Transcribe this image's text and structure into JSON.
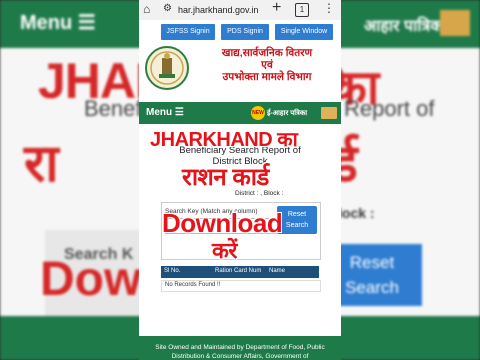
{
  "background": {
    "menu": "Menu ☰",
    "right_text": "आहार पात्रिका",
    "caption_jharkhand": "JHARKHAND",
    "caption_ka": "का",
    "report_left": "Beneficiary",
    "report_right": "Report of",
    "card_left": "रा",
    "card_right": "र्ड",
    "search_key": "Search K",
    "download": "Dow",
    "block": "lock :",
    "reset": "Reset Search"
  },
  "browser": {
    "url": "har.jharkhand.gov.in",
    "tab_count": "1",
    "home_icon": "⌂",
    "tune_icon": "⚙",
    "plus_icon": "+",
    "more_icon": "⋮"
  },
  "top_buttons": [
    "JSFSS Signin",
    "PDS Signin",
    "Single Window"
  ],
  "department": {
    "line1": "खाद्य,सार्वजनिक वितरण",
    "line2": "एवं",
    "line3": "उपभोक्ता मामले विभाग"
  },
  "nav": {
    "menu": "Menu ☰",
    "new_badge": "NEW",
    "eahar": "ई-आहार पत्रिका"
  },
  "section": {
    "title_line1": "Beneficiary Search Report of",
    "title_line2": "District  Block",
    "district_label": "District : , Block :",
    "search_key": "Search Key (Match any column)",
    "reset_button": "Reset Search"
  },
  "table": {
    "headers": [
      "Sl No.",
      "Ration Card Num",
      "Name"
    ],
    "empty_message": "No Records Found !!"
  },
  "footer": {
    "text": "Site Owned and Maintained by Department of Food, Public Distribution & Consumer Affairs, Government of"
  },
  "overlay_caption": {
    "line1": "JHARKHAND का",
    "line2": "राशन कार्ड",
    "line3": "Download",
    "line4": "करें"
  },
  "colors": {
    "header_green": "#1f7a4a",
    "button_blue": "#2e7dd1",
    "caption_red": "#e4141a",
    "table_header": "#1e4f79"
  }
}
